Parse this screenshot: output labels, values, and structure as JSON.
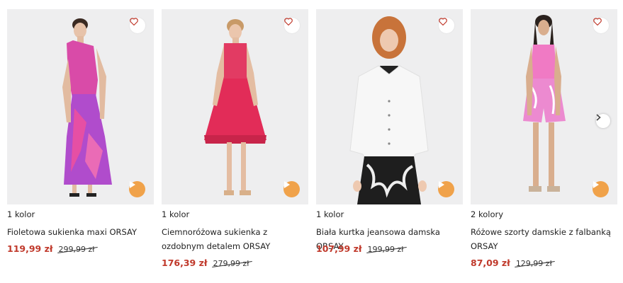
{
  "accent_price_color": "#c0392b",
  "play_button_color": "#f0a24a",
  "icons": {
    "favorite": "heart-outline-icon",
    "play": "play-icon",
    "next": "chevron-right-icon"
  },
  "products": [
    {
      "colors": "1 kolor",
      "name": "Fioletowa sukienka maxi ORSAY",
      "price": "119,99 zł",
      "old_price": "299,99 zł"
    },
    {
      "colors": "1 kolor",
      "name": "Ciemnoróżowa sukienka z ozdobnym detalem ORSAY",
      "price": "176,39 zł",
      "old_price": "279,99 zł"
    },
    {
      "colors": "1 kolor",
      "name": "Biała kurtka jeansowa damska ORSAY",
      "price": "107,99 zł",
      "old_price": "199,99 zł"
    },
    {
      "colors": "2 kolory",
      "name": "Różowe szorty damskie z falbanką ORSAY",
      "price": "87,09 zł",
      "old_price": "129,99 zł"
    }
  ]
}
